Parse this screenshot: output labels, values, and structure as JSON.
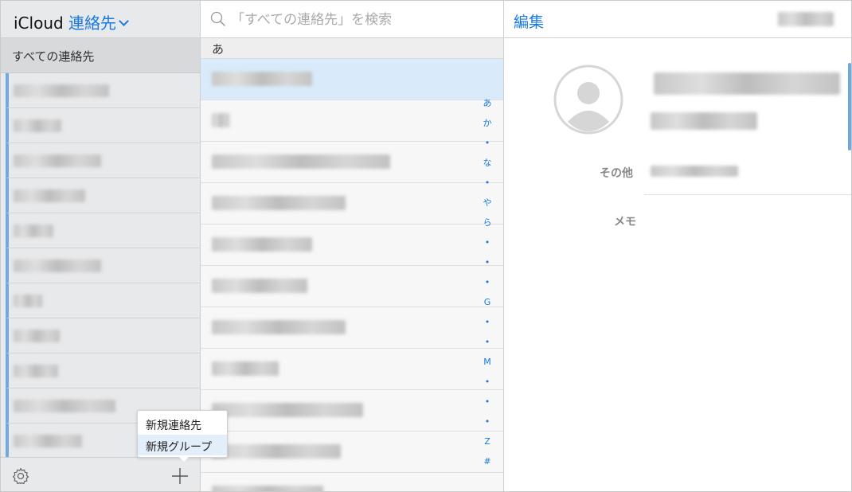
{
  "sidebar": {
    "title_prefix": "iCloud",
    "title_app": "連絡先",
    "all_contacts": "すべての連絡先",
    "group_count": 11
  },
  "popup": {
    "new_contact": "新規連絡先",
    "new_group": "新規グループ"
  },
  "list": {
    "search_placeholder": "「すべての連絡先」を検索",
    "section_header": "あ",
    "index": [
      "あ",
      "か",
      "•",
      "な",
      "•",
      "や",
      "ら",
      "•",
      "•",
      "•",
      "G",
      "•",
      "•",
      "M",
      "•",
      "•",
      "•",
      "Z",
      "#"
    ]
  },
  "detail": {
    "edit_label": "編集",
    "label_other": "その他",
    "label_memo": "メモ"
  },
  "colors": {
    "accent": "#1a7ae0",
    "selection": "#d9ebfb",
    "sidebar_bg": "#e8e9eb"
  }
}
